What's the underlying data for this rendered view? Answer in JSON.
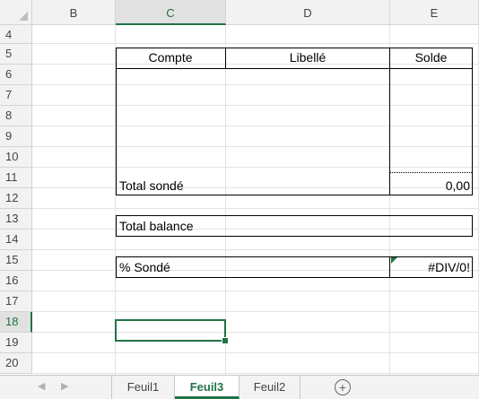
{
  "columns": [
    "B",
    "C",
    "D",
    "E"
  ],
  "selected_column": "C",
  "rows": [
    "4",
    "5",
    "6",
    "7",
    "8",
    "9",
    "10",
    "11",
    "12",
    "13",
    "14",
    "15",
    "16",
    "17",
    "18",
    "19",
    "20"
  ],
  "selected_row": "18",
  "cells": {
    "header_compte": "Compte",
    "header_libelle": "Libellé",
    "header_solde": "Solde",
    "total_sonde_label": "Total sondé",
    "total_sonde_value": "0,00",
    "total_balance_label": "Total balance",
    "pct_sonde_label": "% Sondé",
    "pct_sonde_value": "#DIV/0!"
  },
  "sheet_tabs": [
    "Feuil1",
    "Feuil3",
    "Feuil2"
  ],
  "active_sheet": "Feuil3",
  "nav": {
    "prev": "◀",
    "next": "▶",
    "add_sheet": "+"
  },
  "colors": {
    "accent": "#217346"
  }
}
